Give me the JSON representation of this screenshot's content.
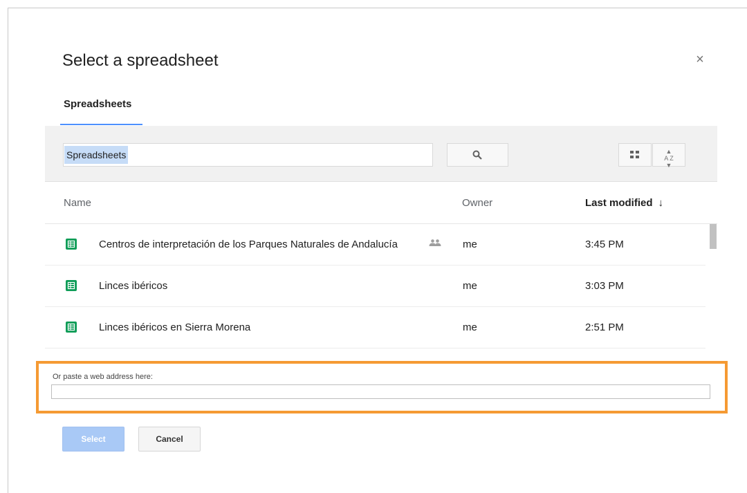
{
  "dialog": {
    "title": "Select a spreadsheet",
    "close_glyph": "×"
  },
  "tabs": [
    {
      "label": "Spreadsheets",
      "active": true
    }
  ],
  "toolbar": {
    "search_value": "Spreadsheets",
    "search_icon": "search-icon",
    "view_icon": "grid-view-icon",
    "sort_icon": "sort-az-icon",
    "sort_glyph": "A Z"
  },
  "columns": {
    "name": "Name",
    "owner": "Owner",
    "modified": "Last modified",
    "modified_sort_arrow": "↓"
  },
  "files": [
    {
      "name": "Centros de interpretación de los Parques Naturales de Andalucía",
      "shared": true,
      "owner": "me",
      "modified": "3:45 PM"
    },
    {
      "name": "Linces ibéricos",
      "shared": false,
      "owner": "me",
      "modified": "3:03 PM"
    },
    {
      "name": "Linces ibéricos en Sierra Morena",
      "shared": false,
      "owner": "me",
      "modified": "2:51 PM"
    }
  ],
  "paste": {
    "label": "Or paste a web address here:",
    "value": ""
  },
  "buttons": {
    "select": "Select",
    "cancel": "Cancel"
  },
  "colors": {
    "accent": "#4d90fe",
    "highlight_border": "#f59a33",
    "sheet_icon": "#0f9d58",
    "select_disabled": "#a9c9f6"
  }
}
